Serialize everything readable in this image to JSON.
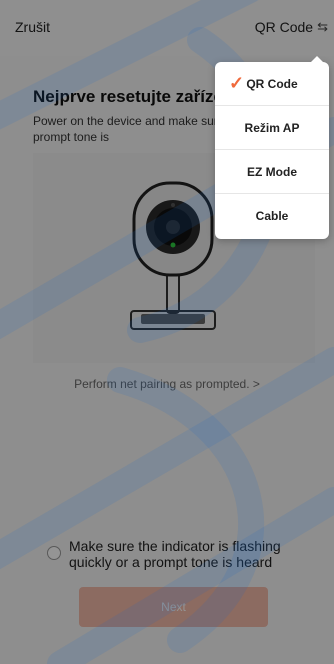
{
  "header": {
    "cancel_label": "Zrušit",
    "mode_label": "QR Code",
    "mode_icon": "swap-arrows-icon"
  },
  "content": {
    "title": "Nejprve resetujte zaříze",
    "description": "Power on the device and make sur flashing rapidly or a prompt tone is",
    "guide_link": "Perform net pairing as prompted. >",
    "confirm_text": "Make sure the indicator is flashing quickly or a prompt tone is heard",
    "next_label": "Next"
  },
  "menu": {
    "items": [
      {
        "label": "QR Code",
        "selected": true
      },
      {
        "label": "Režim AP",
        "selected": false
      },
      {
        "label": "EZ Mode",
        "selected": false
      },
      {
        "label": "Cable",
        "selected": false
      }
    ]
  },
  "colors": {
    "accent": "#f06a3c",
    "next_button": "#f2b8a8",
    "watermark": "#1e6cc8"
  }
}
